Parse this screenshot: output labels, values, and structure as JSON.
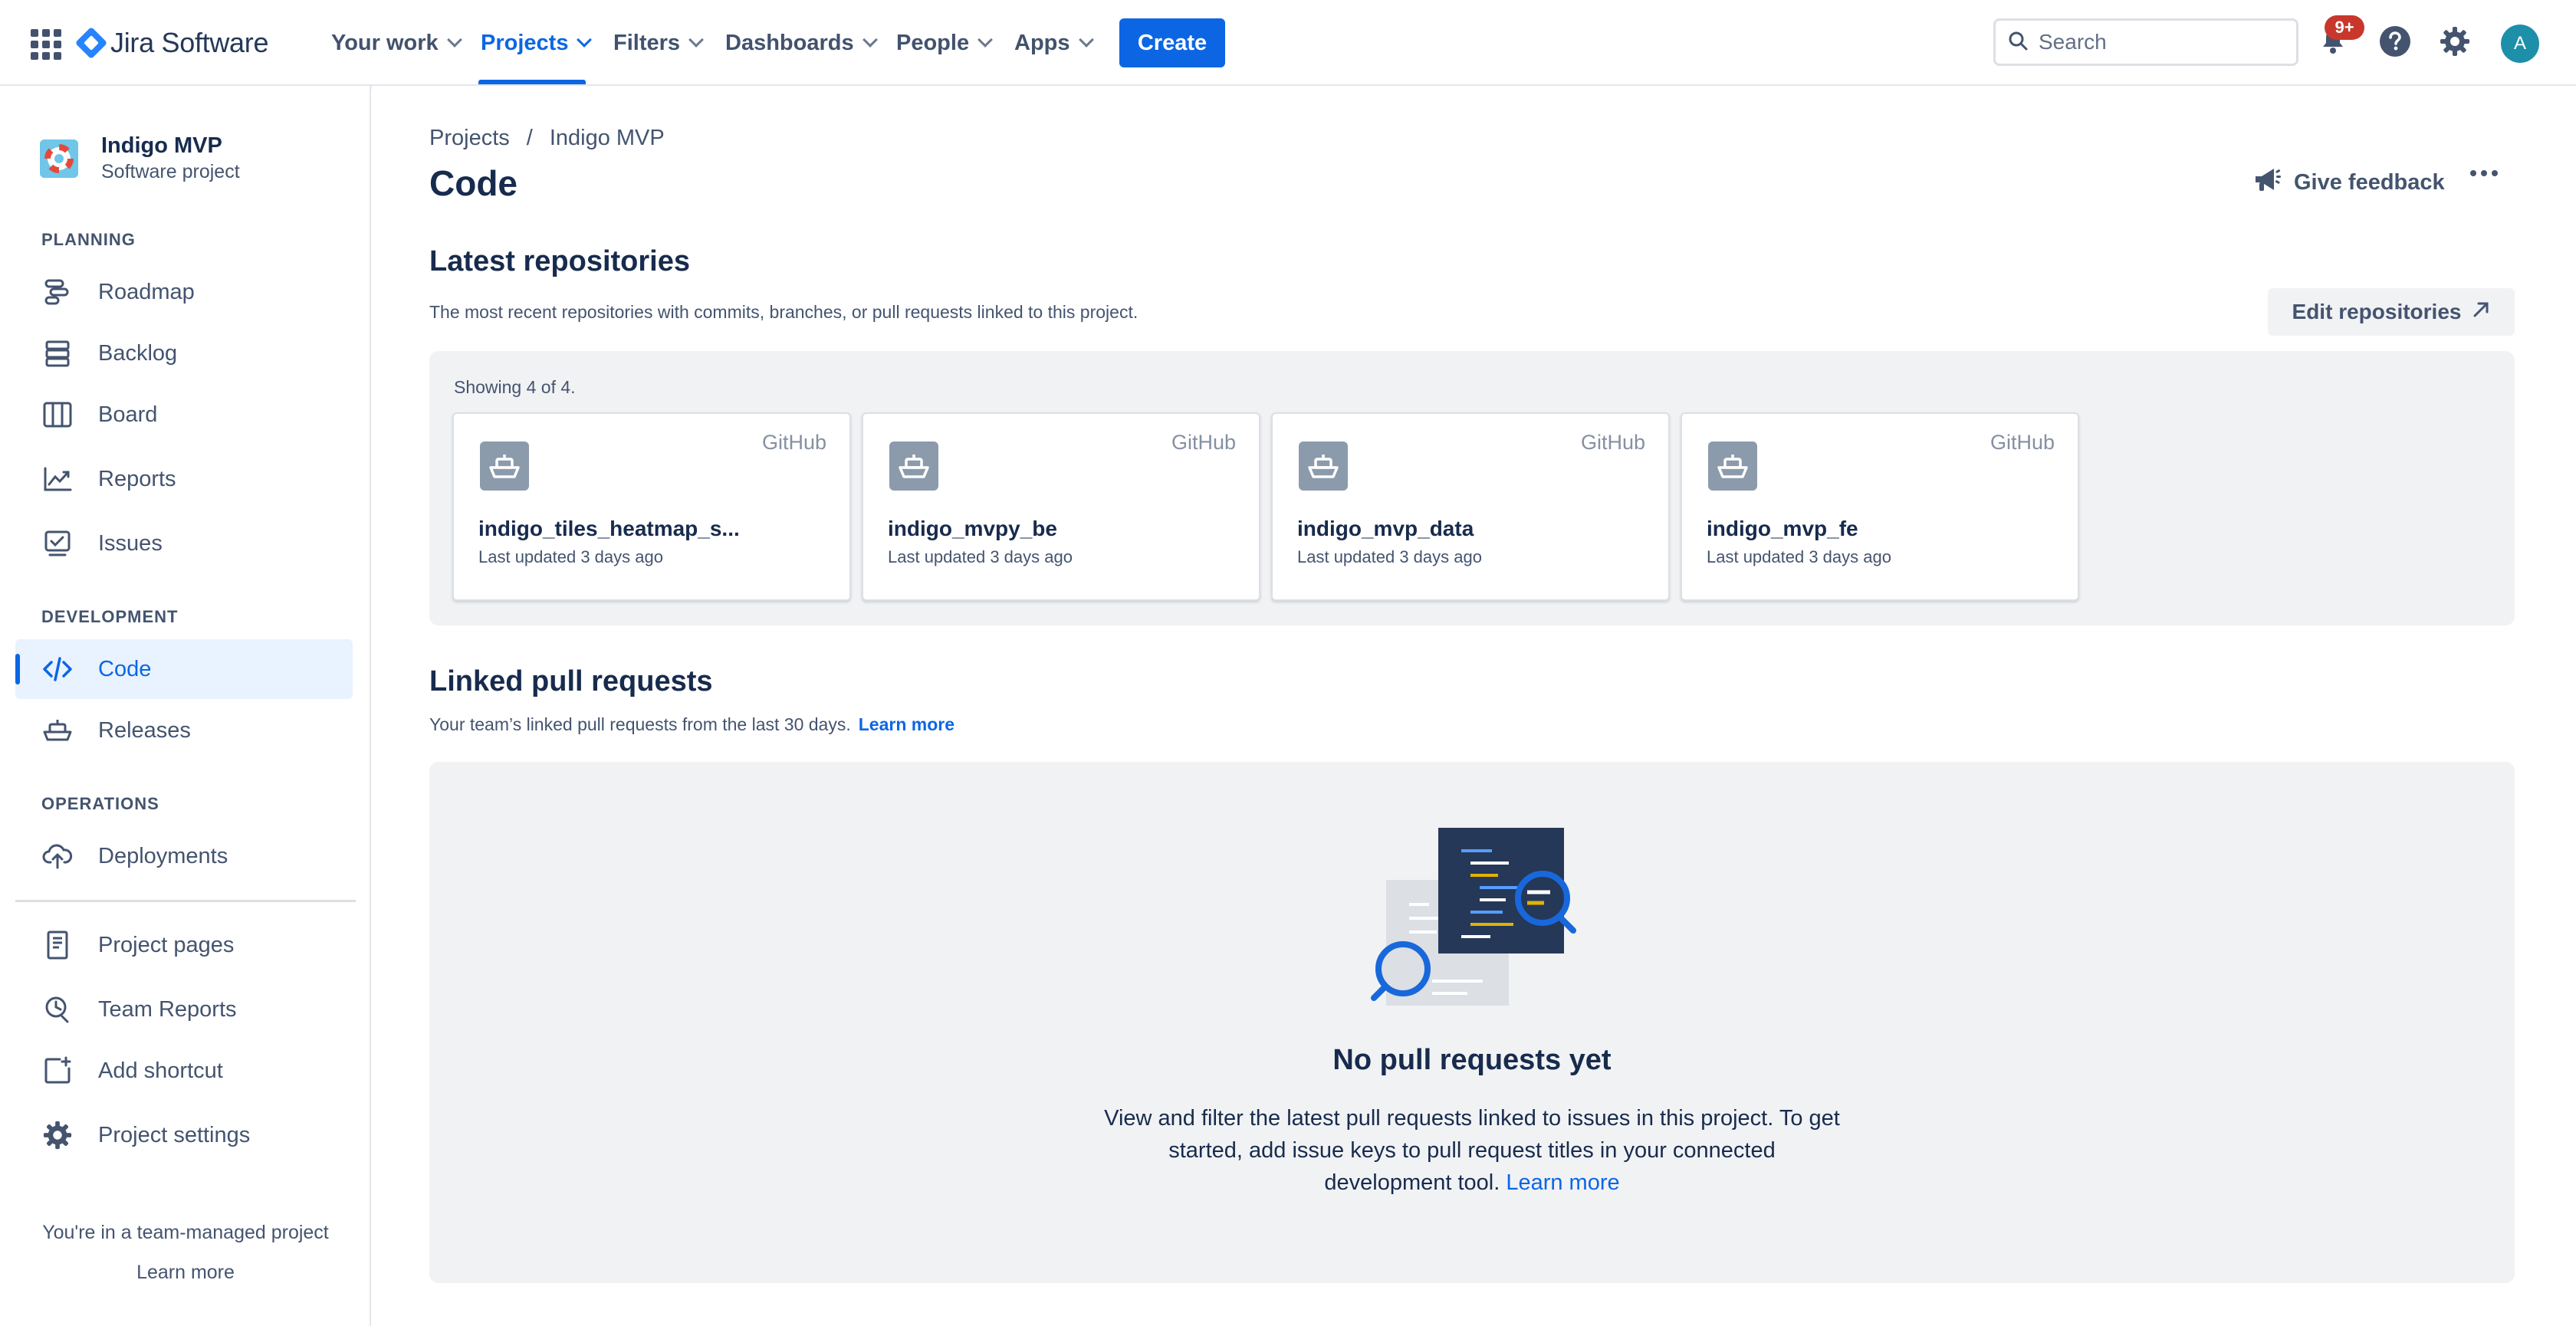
{
  "topnav": {
    "product": "Jira Software",
    "items": [
      {
        "label": "Your work"
      },
      {
        "label": "Projects"
      },
      {
        "label": "Filters"
      },
      {
        "label": "Dashboards"
      },
      {
        "label": "People"
      },
      {
        "label": "Apps"
      }
    ],
    "active_item": "Projects",
    "create_label": "Create",
    "search_placeholder": "Search",
    "notification_badge": "9+",
    "avatar_initial": "A"
  },
  "sidebar": {
    "project_name": "Indigo MVP",
    "project_type": "Software project",
    "sections": {
      "planning": "PLANNING",
      "development": "DEVELOPMENT",
      "operations": "OPERATIONS"
    },
    "planning_items": [
      {
        "label": "Roadmap",
        "icon": "roadmap-icon"
      },
      {
        "label": "Backlog",
        "icon": "backlog-icon"
      },
      {
        "label": "Board",
        "icon": "board-icon"
      },
      {
        "label": "Reports",
        "icon": "reports-icon"
      },
      {
        "label": "Issues",
        "icon": "issues-icon"
      }
    ],
    "development_items": [
      {
        "label": "Code",
        "icon": "code-icon",
        "active": true
      },
      {
        "label": "Releases",
        "icon": "releases-icon"
      }
    ],
    "operations_items": [
      {
        "label": "Deployments",
        "icon": "cloud-upload-icon"
      }
    ],
    "other_items": [
      {
        "label": "Project pages",
        "icon": "page-icon"
      },
      {
        "label": "Team Reports",
        "icon": "team-reports-icon"
      },
      {
        "label": "Add shortcut",
        "icon": "add-shortcut-icon"
      },
      {
        "label": "Project settings",
        "icon": "gear-icon"
      }
    ],
    "footer_text": "You're in a team-managed project",
    "footer_link": "Learn more"
  },
  "main": {
    "breadcrumb": [
      "Projects",
      "/",
      "Indigo MVP"
    ],
    "title": "Code",
    "feedback_label": "Give feedback",
    "repos": {
      "heading": "Latest repositories",
      "description": "The most recent repositories with commits, branches, or pull requests linked to this project.",
      "edit_label": "Edit repositories",
      "showing": "Showing 4 of 4.",
      "items": [
        {
          "name": "indigo_tiles_heatmap_s...",
          "provider": "GitHub",
          "updated": "Last updated 3 days ago"
        },
        {
          "name": "indigo_mvpy_be",
          "provider": "GitHub",
          "updated": "Last updated 3 days ago"
        },
        {
          "name": "indigo_mvp_data",
          "provider": "GitHub",
          "updated": "Last updated 3 days ago"
        },
        {
          "name": "indigo_mvp_fe",
          "provider": "GitHub",
          "updated": "Last updated 3 days ago"
        }
      ]
    },
    "pull_requests": {
      "heading": "Linked pull requests",
      "description": "Your team’s linked pull requests from the last 30 days.",
      "learn_more": "Learn more",
      "empty_title": "No pull requests yet",
      "empty_text": "View and filter the latest pull requests linked to issues in this project. To get started, add issue keys to pull request titles in your connected development tool.",
      "empty_link": "Learn more"
    }
  },
  "colors": {
    "brand": "#0c66e4",
    "active_bg": "#e9f2ff",
    "panel_bg": "#f1f2f4",
    "badge": "#c9372c"
  }
}
